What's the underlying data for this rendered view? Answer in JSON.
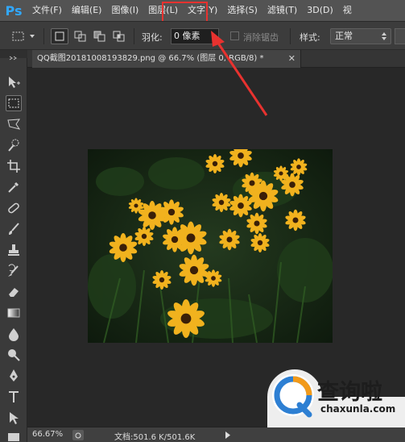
{
  "app": {
    "logo": "Ps"
  },
  "menu": [
    "文件(F)",
    "编辑(E)",
    "图像(I)",
    "图层(L)",
    "文字(Y)",
    "选择(S)",
    "滤镜(T)",
    "3D(D)",
    "视"
  ],
  "options": {
    "feather_label": "羽化:",
    "feather_value": "0 像素",
    "antialias_label": "消除锯齿",
    "style_label": "样式:",
    "style_value": "正常"
  },
  "document": {
    "tab_title": "QQ截图20181008193829.png @ 66.7% (图层 0, RGB/8) *"
  },
  "status": {
    "zoom": "66.67%",
    "doc_size": "文档:501.6 K/501.6K"
  },
  "watermark": {
    "brand_cn": "查询啦",
    "brand_url": "chaxunla.com"
  },
  "colors": {
    "highlight": "#e8322f",
    "ps_blue": "#31a8ff"
  }
}
